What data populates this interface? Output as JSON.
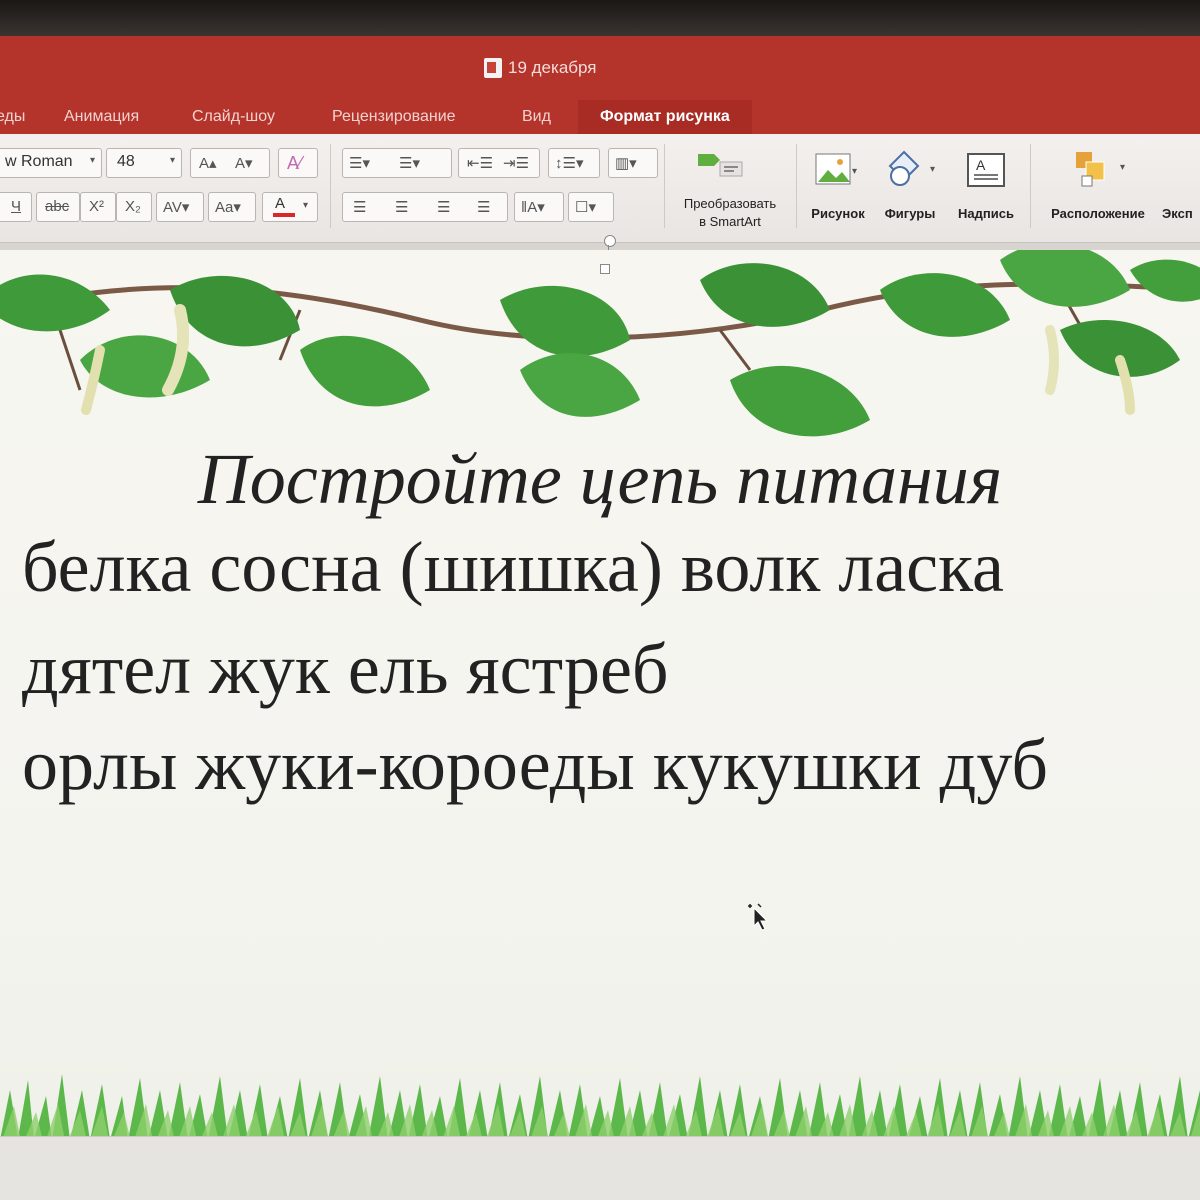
{
  "window": {
    "title": "19 декабря"
  },
  "tabs": [
    {
      "label": "еды",
      "active": false
    },
    {
      "label": "Анимация",
      "active": false
    },
    {
      "label": "Слайд-шоу",
      "active": false
    },
    {
      "label": "Рецензирование",
      "active": false
    },
    {
      "label": "Вид",
      "active": false
    },
    {
      "label": "Формат рисунка",
      "active": true
    }
  ],
  "font": {
    "name": "w Roman",
    "size": "48"
  },
  "ribbon": {
    "smartart_line1": "Преобразовать",
    "smartart_line2": "в SmartArt",
    "picture": "Рисунок",
    "shapes": "Фигуры",
    "textbox": "Надпись",
    "arrange": "Расположение",
    "export": "Эксп"
  },
  "slide": {
    "title": "Постройте цепь питания",
    "lines": [
      "белка сосна (шишка) волк ласка",
      "дятел  жук ель ястреб",
      "орлы жуки-короеды кукушки дуб"
    ]
  },
  "colors": {
    "titlebar": "#b4332b",
    "active_tab": "#a82b24",
    "leaf": "#3f9a3a",
    "grass": "#5cb84a"
  }
}
